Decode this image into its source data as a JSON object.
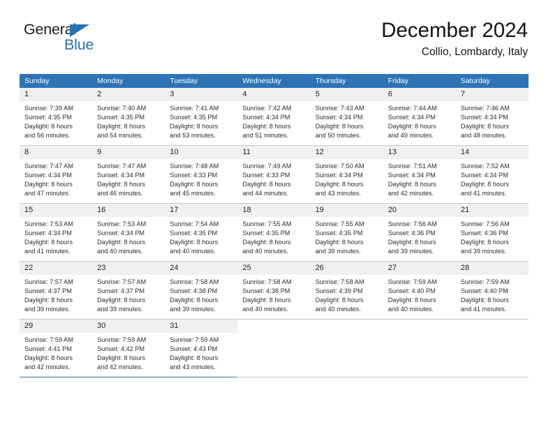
{
  "brand": {
    "name_part1": "General",
    "name_part2": "Blue",
    "flag_icon": "triangle-flag-icon",
    "accent_color": "#2272b8"
  },
  "header": {
    "title": "December 2024",
    "subtitle": "Collio, Lombardy, Italy"
  },
  "calendar": {
    "header_bg": "#2e74b5",
    "daynum_bg": "#f0f0f0",
    "weekdays": [
      "Sunday",
      "Monday",
      "Tuesday",
      "Wednesday",
      "Thursday",
      "Friday",
      "Saturday"
    ],
    "weeks": [
      [
        {
          "day": "1",
          "sunrise": "Sunrise: 7:39 AM",
          "sunset": "Sunset: 4:35 PM",
          "daylight1": "Daylight: 8 hours",
          "daylight2": "and 56 minutes."
        },
        {
          "day": "2",
          "sunrise": "Sunrise: 7:40 AM",
          "sunset": "Sunset: 4:35 PM",
          "daylight1": "Daylight: 8 hours",
          "daylight2": "and 54 minutes."
        },
        {
          "day": "3",
          "sunrise": "Sunrise: 7:41 AM",
          "sunset": "Sunset: 4:35 PM",
          "daylight1": "Daylight: 8 hours",
          "daylight2": "and 53 minutes."
        },
        {
          "day": "4",
          "sunrise": "Sunrise: 7:42 AM",
          "sunset": "Sunset: 4:34 PM",
          "daylight1": "Daylight: 8 hours",
          "daylight2": "and 51 minutes."
        },
        {
          "day": "5",
          "sunrise": "Sunrise: 7:43 AM",
          "sunset": "Sunset: 4:34 PM",
          "daylight1": "Daylight: 8 hours",
          "daylight2": "and 50 minutes."
        },
        {
          "day": "6",
          "sunrise": "Sunrise: 7:44 AM",
          "sunset": "Sunset: 4:34 PM",
          "daylight1": "Daylight: 8 hours",
          "daylight2": "and 49 minutes."
        },
        {
          "day": "7",
          "sunrise": "Sunrise: 7:46 AM",
          "sunset": "Sunset: 4:34 PM",
          "daylight1": "Daylight: 8 hours",
          "daylight2": "and 48 minutes."
        }
      ],
      [
        {
          "day": "8",
          "sunrise": "Sunrise: 7:47 AM",
          "sunset": "Sunset: 4:34 PM",
          "daylight1": "Daylight: 8 hours",
          "daylight2": "and 47 minutes."
        },
        {
          "day": "9",
          "sunrise": "Sunrise: 7:47 AM",
          "sunset": "Sunset: 4:34 PM",
          "daylight1": "Daylight: 8 hours",
          "daylight2": "and 46 minutes."
        },
        {
          "day": "10",
          "sunrise": "Sunrise: 7:48 AM",
          "sunset": "Sunset: 4:33 PM",
          "daylight1": "Daylight: 8 hours",
          "daylight2": "and 45 minutes."
        },
        {
          "day": "11",
          "sunrise": "Sunrise: 7:49 AM",
          "sunset": "Sunset: 4:33 PM",
          "daylight1": "Daylight: 8 hours",
          "daylight2": "and 44 minutes."
        },
        {
          "day": "12",
          "sunrise": "Sunrise: 7:50 AM",
          "sunset": "Sunset: 4:34 PM",
          "daylight1": "Daylight: 8 hours",
          "daylight2": "and 43 minutes."
        },
        {
          "day": "13",
          "sunrise": "Sunrise: 7:51 AM",
          "sunset": "Sunset: 4:34 PM",
          "daylight1": "Daylight: 8 hours",
          "daylight2": "and 42 minutes."
        },
        {
          "day": "14",
          "sunrise": "Sunrise: 7:52 AM",
          "sunset": "Sunset: 4:34 PM",
          "daylight1": "Daylight: 8 hours",
          "daylight2": "and 41 minutes."
        }
      ],
      [
        {
          "day": "15",
          "sunrise": "Sunrise: 7:53 AM",
          "sunset": "Sunset: 4:34 PM",
          "daylight1": "Daylight: 8 hours",
          "daylight2": "and 41 minutes."
        },
        {
          "day": "16",
          "sunrise": "Sunrise: 7:53 AM",
          "sunset": "Sunset: 4:34 PM",
          "daylight1": "Daylight: 8 hours",
          "daylight2": "and 40 minutes."
        },
        {
          "day": "17",
          "sunrise": "Sunrise: 7:54 AM",
          "sunset": "Sunset: 4:35 PM",
          "daylight1": "Daylight: 8 hours",
          "daylight2": "and 40 minutes."
        },
        {
          "day": "18",
          "sunrise": "Sunrise: 7:55 AM",
          "sunset": "Sunset: 4:35 PM",
          "daylight1": "Daylight: 8 hours",
          "daylight2": "and 40 minutes."
        },
        {
          "day": "19",
          "sunrise": "Sunrise: 7:55 AM",
          "sunset": "Sunset: 4:35 PM",
          "daylight1": "Daylight: 8 hours",
          "daylight2": "and 39 minutes."
        },
        {
          "day": "20",
          "sunrise": "Sunrise: 7:56 AM",
          "sunset": "Sunset: 4:36 PM",
          "daylight1": "Daylight: 8 hours",
          "daylight2": "and 39 minutes."
        },
        {
          "day": "21",
          "sunrise": "Sunrise: 7:56 AM",
          "sunset": "Sunset: 4:36 PM",
          "daylight1": "Daylight: 8 hours",
          "daylight2": "and 39 minutes."
        }
      ],
      [
        {
          "day": "22",
          "sunrise": "Sunrise: 7:57 AM",
          "sunset": "Sunset: 4:37 PM",
          "daylight1": "Daylight: 8 hours",
          "daylight2": "and 39 minutes."
        },
        {
          "day": "23",
          "sunrise": "Sunrise: 7:57 AM",
          "sunset": "Sunset: 4:37 PM",
          "daylight1": "Daylight: 8 hours",
          "daylight2": "and 39 minutes."
        },
        {
          "day": "24",
          "sunrise": "Sunrise: 7:58 AM",
          "sunset": "Sunset: 4:38 PM",
          "daylight1": "Daylight: 8 hours",
          "daylight2": "and 39 minutes."
        },
        {
          "day": "25",
          "sunrise": "Sunrise: 7:58 AM",
          "sunset": "Sunset: 4:38 PM",
          "daylight1": "Daylight: 8 hours",
          "daylight2": "and 40 minutes."
        },
        {
          "day": "26",
          "sunrise": "Sunrise: 7:58 AM",
          "sunset": "Sunset: 4:39 PM",
          "daylight1": "Daylight: 8 hours",
          "daylight2": "and 40 minutes."
        },
        {
          "day": "27",
          "sunrise": "Sunrise: 7:59 AM",
          "sunset": "Sunset: 4:40 PM",
          "daylight1": "Daylight: 8 hours",
          "daylight2": "and 40 minutes."
        },
        {
          "day": "28",
          "sunrise": "Sunrise: 7:59 AM",
          "sunset": "Sunset: 4:40 PM",
          "daylight1": "Daylight: 8 hours",
          "daylight2": "and 41 minutes."
        }
      ],
      [
        {
          "day": "29",
          "sunrise": "Sunrise: 7:59 AM",
          "sunset": "Sunset: 4:41 PM",
          "daylight1": "Daylight: 8 hours",
          "daylight2": "and 42 minutes."
        },
        {
          "day": "30",
          "sunrise": "Sunrise: 7:59 AM",
          "sunset": "Sunset: 4:42 PM",
          "daylight1": "Daylight: 8 hours",
          "daylight2": "and 42 minutes."
        },
        {
          "day": "31",
          "sunrise": "Sunrise: 7:59 AM",
          "sunset": "Sunset: 4:43 PM",
          "daylight1": "Daylight: 8 hours",
          "daylight2": "and 43 minutes."
        },
        {
          "day": "",
          "sunrise": "",
          "sunset": "",
          "daylight1": "",
          "daylight2": ""
        },
        {
          "day": "",
          "sunrise": "",
          "sunset": "",
          "daylight1": "",
          "daylight2": ""
        },
        {
          "day": "",
          "sunrise": "",
          "sunset": "",
          "daylight1": "",
          "daylight2": ""
        },
        {
          "day": "",
          "sunrise": "",
          "sunset": "",
          "daylight1": "",
          "daylight2": ""
        }
      ]
    ]
  }
}
